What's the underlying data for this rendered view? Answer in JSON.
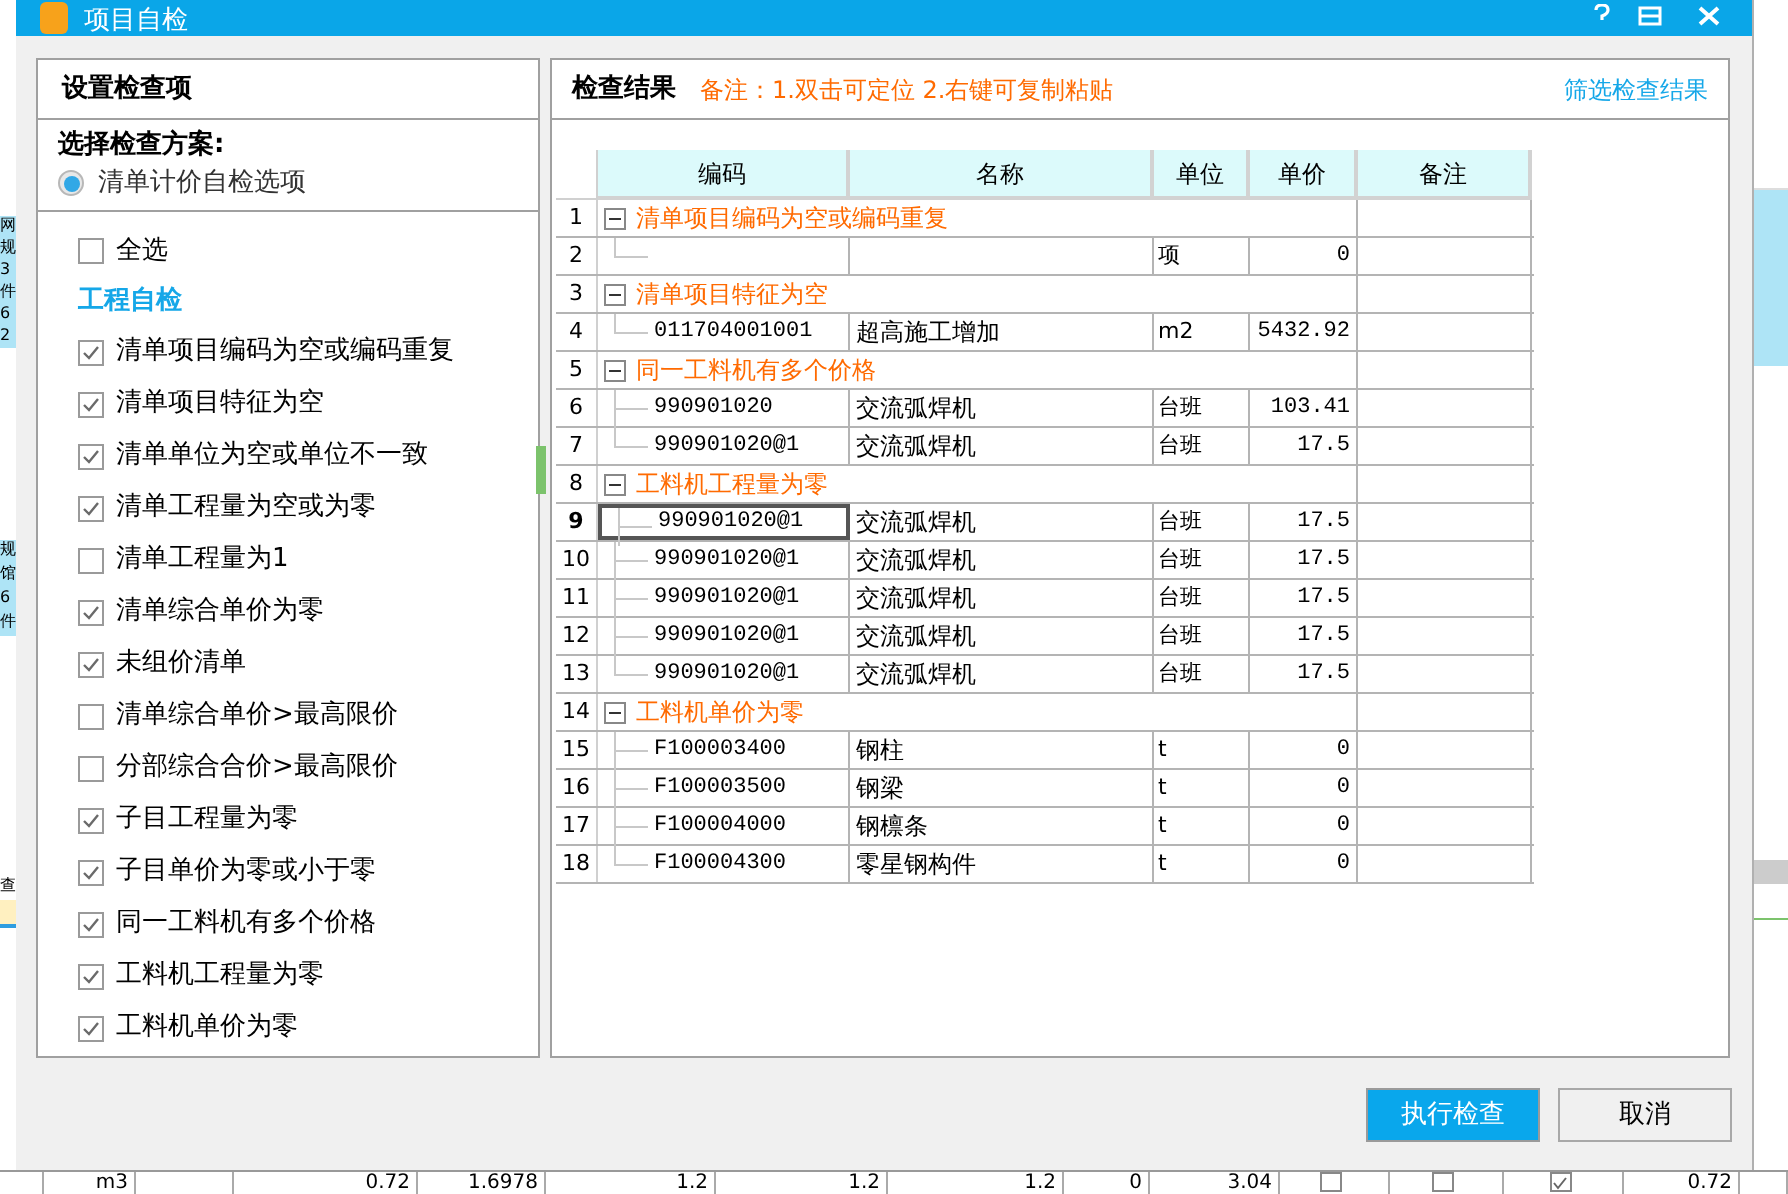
{
  "window": {
    "title": "项目自检"
  },
  "settings_panel": {
    "title": "设置检查项",
    "scheme_label": "选择检查方案:",
    "scheme_options": [
      {
        "label": "清单计价自检选项",
        "selected": true
      }
    ],
    "select_all": {
      "label": "全选",
      "checked": false
    },
    "section_title": "工程自检",
    "checks": [
      {
        "label": "清单项目编码为空或编码重复",
        "checked": true
      },
      {
        "label": "清单项目特征为空",
        "checked": true
      },
      {
        "label": "清单单位为空或单位不一致",
        "checked": true
      },
      {
        "label": "清单工程量为空或为零",
        "checked": true
      },
      {
        "label": "清单工程量为1",
        "checked": false
      },
      {
        "label": "清单综合单价为零",
        "checked": true
      },
      {
        "label": "未组价清单",
        "checked": true
      },
      {
        "label": "清单综合单价>最高限价",
        "checked": false
      },
      {
        "label": "分部综合合价>最高限价",
        "checked": false
      },
      {
        "label": "子目工程量为零",
        "checked": true
      },
      {
        "label": "子目单价为零或小于零",
        "checked": true
      },
      {
        "label": "同一工料机有多个价格",
        "checked": true
      },
      {
        "label": "工料机工程量为零",
        "checked": true
      },
      {
        "label": "工料机单价为零",
        "checked": true
      }
    ]
  },
  "results_panel": {
    "title": "检查结果",
    "note": "备注：1.双击可定位 2.右键可复制粘贴",
    "filter_link": "筛选检查结果",
    "table": {
      "columns": [
        "编码",
        "名称",
        "单位",
        "单价",
        "备注"
      ],
      "groups": [
        {
          "no": "1",
          "label": "清单项目编码为空或编码重复",
          "expanded": true,
          "children": [
            {
              "no": "2",
              "unit": "项",
              "price": "0",
              "selected": false
            }
          ]
        },
        {
          "no": "3",
          "label": "清单项目特征为空",
          "expanded": true,
          "children": [
            {
              "no": "4",
              "code": "011704001001",
              "name": "超高施工增加",
              "unit": "m2",
              "price": "5432.92",
              "selected": false
            }
          ]
        },
        {
          "no": "5",
          "label": "同一工料机有多个价格",
          "expanded": true,
          "children": [
            {
              "no": "6",
              "code": "990901020",
              "name": "交流弧焊机",
              "unit": "台班",
              "price": "103.41",
              "selected": false
            },
            {
              "no": "7",
              "code": "990901020@1",
              "name": "交流弧焊机",
              "unit": "台班",
              "price": "17.5",
              "selected": false
            }
          ]
        },
        {
          "no": "8",
          "label": "工料机工程量为零",
          "expanded": true,
          "children": [
            {
              "no": "9",
              "code": "990901020@1",
              "name": "交流弧焊机",
              "unit": "台班",
              "price": "17.5",
              "selected": true
            },
            {
              "no": "10",
              "code": "990901020@1",
              "name": "交流弧焊机",
              "unit": "台班",
              "price": "17.5",
              "selected": false
            },
            {
              "no": "11",
              "code": "990901020@1",
              "name": "交流弧焊机",
              "unit": "台班",
              "price": "17.5",
              "selected": false
            },
            {
              "no": "12",
              "code": "990901020@1",
              "name": "交流弧焊机",
              "unit": "台班",
              "price": "17.5",
              "selected": false
            },
            {
              "no": "13",
              "code": "990901020@1",
              "name": "交流弧焊机",
              "unit": "台班",
              "price": "17.5",
              "selected": false
            }
          ]
        },
        {
          "no": "14",
          "label": "工料机单价为零",
          "expanded": true,
          "children": [
            {
              "no": "15",
              "code": "F100003400",
              "name": "钢柱",
              "unit": "t",
              "price": "0",
              "selected": false
            },
            {
              "no": "16",
              "code": "F100003500",
              "name": "钢梁",
              "unit": "t",
              "price": "0",
              "selected": false
            },
            {
              "no": "17",
              "code": "F100004000",
              "name": "钢檩条",
              "unit": "t",
              "price": "0",
              "selected": false
            },
            {
              "no": "18",
              "code": "F100004300",
              "name": "零星钢构件",
              "unit": "t",
              "price": "0",
              "selected": false
            }
          ]
        }
      ]
    }
  },
  "buttons": [
    {
      "label": "执行检查",
      "kind": "primary"
    },
    {
      "label": "取消",
      "kind": "secondary"
    }
  ],
  "background_sheet": {
    "left_fragments": [
      "网",
      "规",
      "3",
      "件",
      "6",
      "2"
    ],
    "left_fragments_2": [
      "规",
      "馆",
      "6",
      "件"
    ],
    "left_fragment_3": "查",
    "bottom_row": [
      {
        "kind": "blank"
      },
      {
        "kind": "text",
        "text": "m3"
      },
      {
        "kind": "blank"
      },
      {
        "kind": "text",
        "text": "0.72"
      },
      {
        "kind": "text",
        "text": "1.6978"
      },
      {
        "kind": "text",
        "text": "1.2"
      },
      {
        "kind": "text",
        "text": "1.2"
      },
      {
        "kind": "text",
        "text": "1.2"
      },
      {
        "kind": "text",
        "text": "0"
      },
      {
        "kind": "text",
        "text": "3.04"
      },
      {
        "kind": "checkbox",
        "checked": false
      },
      {
        "kind": "checkbox",
        "checked": false
      },
      {
        "kind": "checkbox",
        "checked": true
      },
      {
        "kind": "text",
        "text": "0.72"
      },
      {
        "kind": "blank"
      }
    ]
  }
}
